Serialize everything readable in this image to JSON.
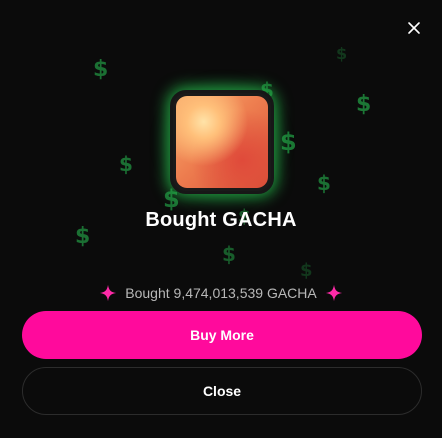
{
  "modal": {
    "close_icon": "close-icon",
    "token_icon": "gacha-token-icon",
    "title": "Bought GACHA",
    "summary": "Bought 9,474,013,539 GACHA",
    "sparkle_icon": "sparkle-icon",
    "sparkle_color": "#ff2aa8",
    "buttons": {
      "buy_more": "Buy More",
      "close": "Close"
    },
    "accent_color": "#ff0a9c",
    "glow_color": "#22c55e",
    "background_icon": "dollar-icon"
  }
}
